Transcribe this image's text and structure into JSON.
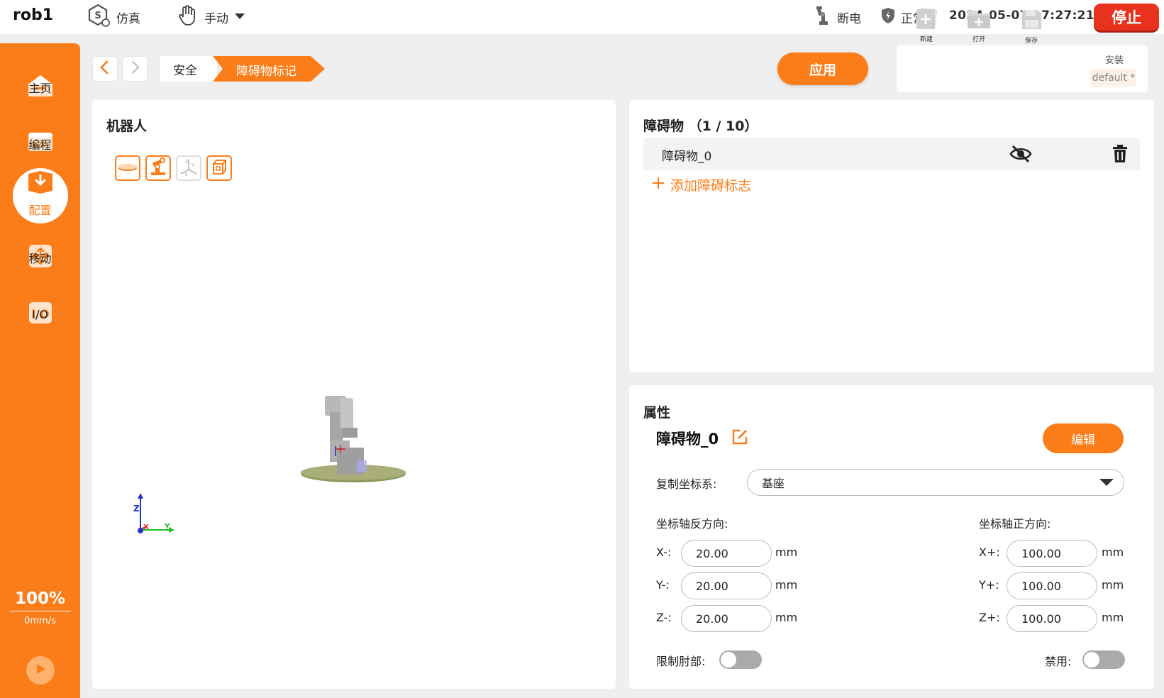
{
  "topbar": {
    "robot_name": "rob1",
    "sim_label": "仿真",
    "mode_label": "手动",
    "power_label": "断电",
    "status_label": "正常",
    "datetime": "2024-05-07 17:27:21",
    "stop_label": "停止"
  },
  "sidebar": {
    "items": [
      {
        "label": "主页",
        "icon": "home-icon"
      },
      {
        "label": "编程",
        "icon": "code-icon"
      },
      {
        "label": "配置",
        "icon": "config-icon"
      },
      {
        "label": "移动",
        "icon": "move-icon"
      },
      {
        "label": "I/O",
        "icon": "io-icon"
      }
    ],
    "speed_pct": "100%",
    "speed_mms": "0mm/s",
    "help": [
      "?",
      "?",
      "?",
      "?"
    ]
  },
  "breadcrumb": {
    "safety": "安全",
    "current": "障碍物标记"
  },
  "toolbar": {
    "apply_label": "应用",
    "new_label": "新建",
    "open_label": "打开",
    "save_label": "保存",
    "install_label": "安装",
    "install_value": "default *"
  },
  "robot_panel": {
    "title": "机器人",
    "axes": {
      "z": "Z",
      "x": "X",
      "y": "Y"
    }
  },
  "obstacles": {
    "title": "障碍物 （1 / 10）",
    "items": [
      {
        "name": "障碍物_0"
      }
    ],
    "add_label": "添加障碍标志"
  },
  "properties": {
    "title": "属性",
    "name": "障碍物_0",
    "edit_label": "编辑",
    "copy_frame_label": "复制坐标系:",
    "copy_frame_value": "基座",
    "neg_label": "坐标轴反方向:",
    "pos_label": "坐标轴正方向:",
    "x_neg_label": "X-:",
    "y_neg_label": "Y-:",
    "z_neg_label": "Z-:",
    "x_pos_label": "X+:",
    "y_pos_label": "Y+:",
    "z_pos_label": "Z+:",
    "x_neg": "20.00",
    "y_neg": "20.00",
    "z_neg": "20.00",
    "x_pos": "100.00",
    "y_pos": "100.00",
    "z_pos": "100.00",
    "unit": "mm",
    "limit_elbow_label": "限制肘部:",
    "disable_label": "禁用:"
  },
  "colors": {
    "accent": "#fa7d19",
    "stop": "#e8321d"
  }
}
